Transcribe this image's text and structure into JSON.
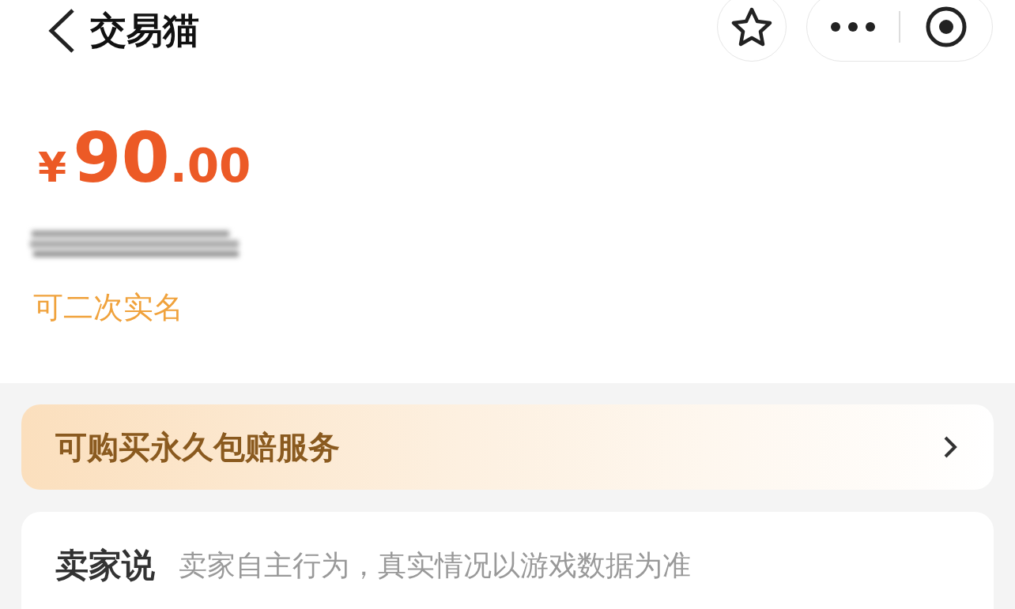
{
  "header": {
    "title": "交易猫"
  },
  "price": {
    "currency": "¥",
    "integer": "90",
    "decimal": ".00"
  },
  "tag": "可二次实名",
  "service_banner": {
    "label": "可购买永久包赔服务"
  },
  "seller_note": {
    "title": "卖家说",
    "note": "卖家自主行为，真实情况以游戏数据为准"
  }
}
